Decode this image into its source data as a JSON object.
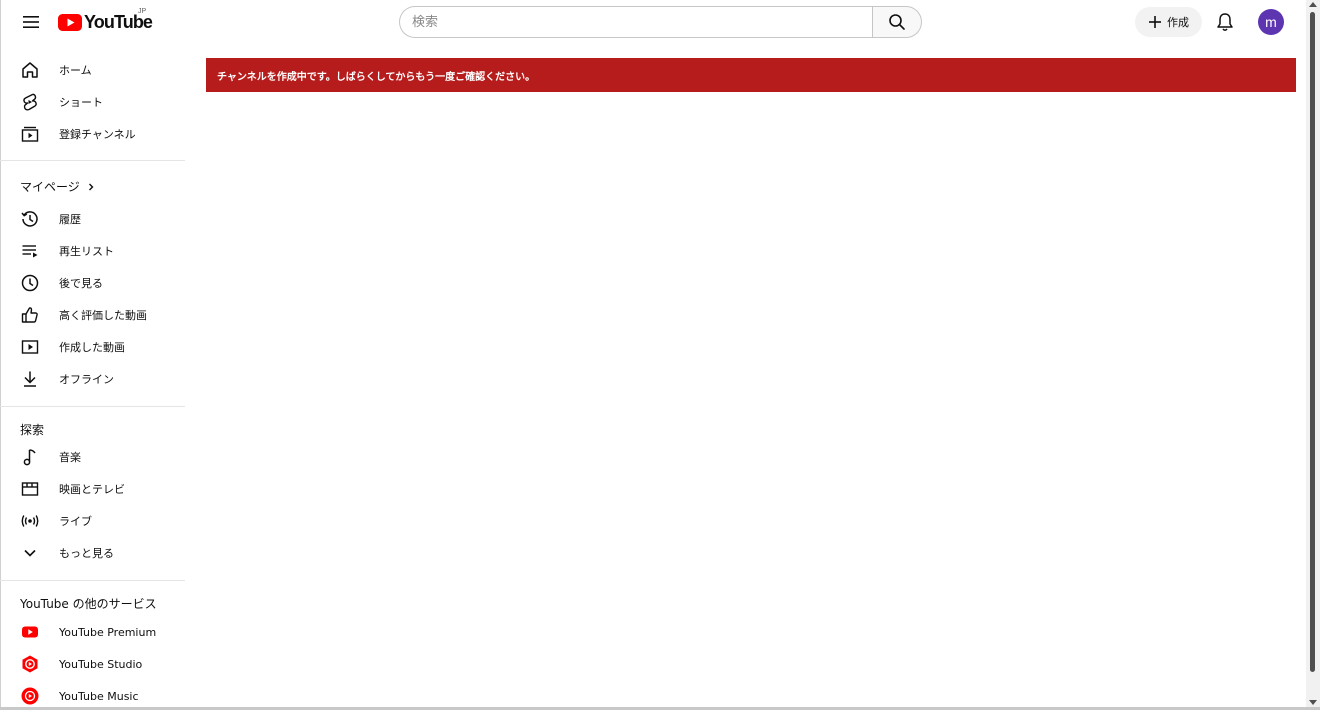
{
  "header": {
    "logo_text": "YouTube",
    "country_code": "JP",
    "search_placeholder": "検索",
    "create_label": "作成",
    "avatar_initial": "m"
  },
  "sidebar": {
    "main_items": [
      {
        "label": "ホーム",
        "icon": "home-icon"
      },
      {
        "label": "ショート",
        "icon": "shorts-icon"
      },
      {
        "label": "登録チャンネル",
        "icon": "subscriptions-icon"
      }
    ],
    "you_title": "マイページ",
    "you_items": [
      {
        "label": "履歴",
        "icon": "history-icon"
      },
      {
        "label": "再生リスト",
        "icon": "playlist-icon"
      },
      {
        "label": "後で見る",
        "icon": "watch-later-icon"
      },
      {
        "label": "高く評価した動画",
        "icon": "thumbs-up-icon"
      },
      {
        "label": "作成した動画",
        "icon": "your-videos-icon"
      },
      {
        "label": "オフライン",
        "icon": "download-icon"
      }
    ],
    "explore_title": "探索",
    "explore_items": [
      {
        "label": "音楽",
        "icon": "music-icon"
      },
      {
        "label": "映画とテレビ",
        "icon": "movies-icon"
      },
      {
        "label": "ライブ",
        "icon": "live-icon"
      },
      {
        "label": "もっと見る",
        "icon": "chevron-down-icon"
      }
    ],
    "more_title": "YouTube の他のサービス",
    "more_items": [
      {
        "label": "YouTube Premium",
        "icon": "youtube-premium-icon"
      },
      {
        "label": "YouTube Studio",
        "icon": "youtube-studio-icon"
      },
      {
        "label": "YouTube Music",
        "icon": "youtube-music-icon"
      }
    ]
  },
  "main": {
    "banner_message": "チャンネルを作成中です。しばらくしてからもう一度ご確認ください。"
  },
  "colors": {
    "brand_red": "#ff0000",
    "banner_bg": "#b71c1c",
    "avatar_bg": "#5e35b1"
  }
}
